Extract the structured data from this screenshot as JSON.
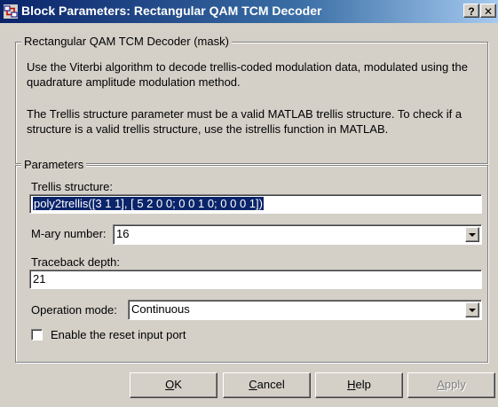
{
  "window": {
    "title": "Block Parameters: Rectangular QAM TCM Decoder",
    "help_label": "?",
    "close_label": "✕"
  },
  "mask": {
    "legend": "Rectangular QAM TCM Decoder (mask)",
    "description_1": "Use the Viterbi algorithm to decode trellis-coded modulation data, modulated using the quadrature amplitude modulation method.",
    "description_2": "The Trellis structure parameter must be a valid MATLAB trellis structure. To check if a structure is a valid trellis structure, use the istrellis function in MATLAB."
  },
  "params": {
    "legend": "Parameters",
    "trellis_label": "Trellis structure:",
    "trellis_value": "poly2trellis([3 1 1], [ 5 2 0 0; 0 0 1 0; 0 0 0 1])",
    "mary_label": "M-ary number:",
    "mary_value": "16",
    "traceback_label": "Traceback depth:",
    "traceback_value": "21",
    "opmode_label": "Operation mode:",
    "opmode_value": "Continuous",
    "reset_label": "Enable the reset input port",
    "reset_checked": false
  },
  "buttons": {
    "ok": {
      "acc": "O",
      "rest": "K"
    },
    "cancel": {
      "acc": "C",
      "rest": "ancel"
    },
    "help": {
      "acc": "H",
      "rest": "elp"
    },
    "apply": {
      "acc": "A",
      "rest": "pply"
    }
  },
  "colors": {
    "face": "#d4d0c8",
    "title_bar": "#0a246a",
    "selection": "#0a246a"
  }
}
